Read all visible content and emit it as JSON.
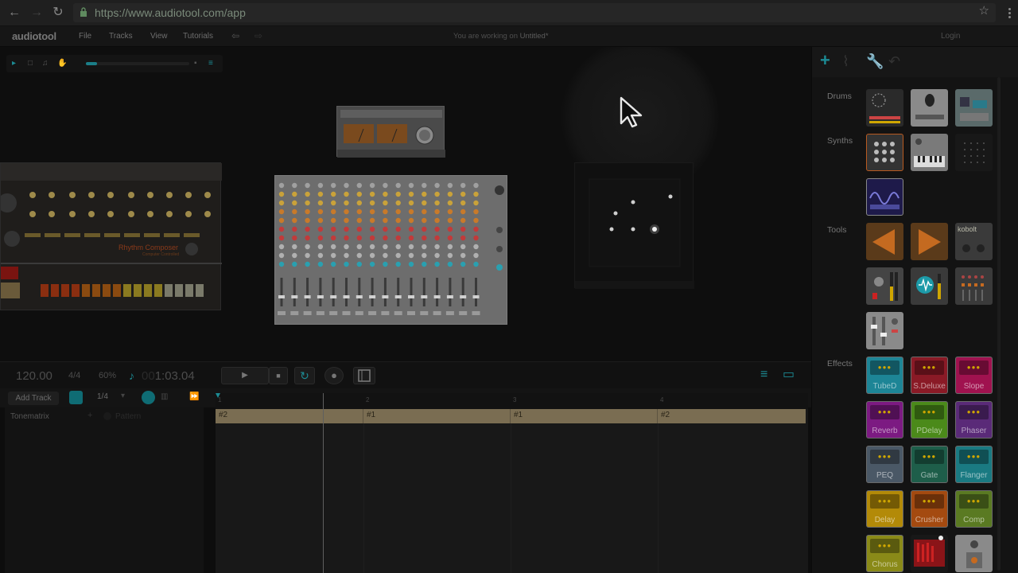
{
  "browser": {
    "url": "https://www.audiotool.com/app",
    "back_icon": "←",
    "forward_icon": "→",
    "reload_icon": "↻",
    "star_icon": "☆"
  },
  "app": {
    "logo": "audiotool",
    "menu": [
      "File",
      "Tracks",
      "View",
      "Tutorials"
    ],
    "undo_icon": "⇦",
    "redo_icon": "⇨",
    "working_prefix": "You are working on",
    "doc_title": "Untitled*",
    "login": "Login"
  },
  "toolbar": {
    "select_icon": "▸",
    "rect_icon": "□",
    "headphones_icon": "♫",
    "hand_icon": "✋",
    "lock_icon": "▪",
    "menu_icon": "≡"
  },
  "devices": {
    "rhythm_composer_label": "Rhythm Composer",
    "rhythm_composer_sub": "Computer Controlled"
  },
  "transport": {
    "bpm": "120.00",
    "signature": "4/4",
    "swing": "60%",
    "note_icon": "♪",
    "time_dim": "00",
    "time": "1:03.04",
    "play_icon": "▶",
    "stop_icon": "■",
    "loop_icon": "↻",
    "record_icon": "●",
    "list_icon": "≡",
    "folder_icon": "▭"
  },
  "tracks": {
    "add_track": "Add Track",
    "quantize": "1/4",
    "quantize_arrow": "▾",
    "track_name": "Tonematrix",
    "pattern_label": "Pattern",
    "plus": "+",
    "ruler": [
      "1",
      "2",
      "3",
      "4"
    ],
    "clips": [
      "#2",
      "#1",
      "#1",
      "#2"
    ]
  },
  "library": {
    "plus_icon": "+",
    "categories": [
      "Drums",
      "Synths",
      "Tools",
      "Effects"
    ],
    "kobolt_label": "kobolt",
    "effects": [
      {
        "label": "TubeD",
        "color": "#1d8596"
      },
      {
        "label": "S.Deluxe",
        "color": "#8a1a26"
      },
      {
        "label": "Slope",
        "color": "#a0124f"
      },
      {
        "label": "Reverb",
        "color": "#7c1a82"
      },
      {
        "label": "PDelay",
        "color": "#4b8a1a"
      },
      {
        "label": "Phaser",
        "color": "#5a2a78"
      },
      {
        "label": "PEQ",
        "color": "#4a5866"
      },
      {
        "label": "Gate",
        "color": "#1e5e4a"
      },
      {
        "label": "Flanger",
        "color": "#1a7a82"
      },
      {
        "label": "Delay",
        "color": "#b38a08"
      },
      {
        "label": "Crusher",
        "color": "#a44a10"
      },
      {
        "label": "Comp",
        "color": "#5a7a22"
      },
      {
        "label": "Chorus",
        "color": "#8a8a18"
      }
    ]
  }
}
